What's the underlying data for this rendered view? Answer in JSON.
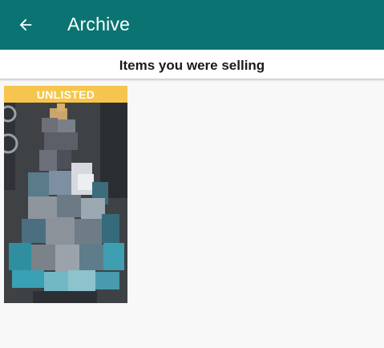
{
  "colors": {
    "app_bar": "#0b7472",
    "badge": "#f6c54d",
    "page_background": "#f8f8f8"
  },
  "app_bar": {
    "back_icon": "arrow-left-icon",
    "title": "Archive"
  },
  "section": {
    "title": "Items you were selling"
  },
  "items": [
    {
      "badge": "UNLISTED",
      "image": "pixelated-item-photo"
    }
  ]
}
